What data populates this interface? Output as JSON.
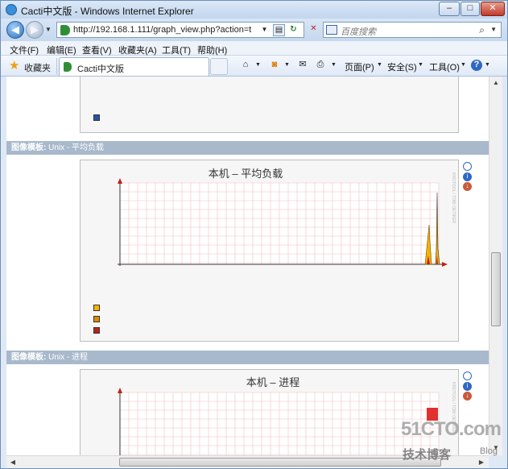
{
  "window": {
    "title": "Cacti中文版 - Windows Internet Explorer",
    "buttons": {
      "minimize": "–",
      "maximize": "□",
      "close": "✕"
    }
  },
  "nav": {
    "url": "http://192.168.1.111/graph_view.php?action=t",
    "search_placeholder": "百度搜索"
  },
  "menu": [
    "文件(F)",
    "编辑(E)",
    "查看(V)",
    "收藏夹(A)",
    "工具(T)",
    "帮助(H)"
  ],
  "favorites": {
    "label": "收藏夹",
    "tab_label": "Cacti中文版"
  },
  "command_bar": {
    "page": "页面(P)",
    "safety": "安全(S)",
    "tools": "工具(O)"
  },
  "content": {
    "sections": [
      {
        "header_label": "图像模板:",
        "header_name": "Unix - 平均负载",
        "graph_title": "本机 – 平均负载",
        "side_text": "RRDTOOL / TOBI OETIKER",
        "legend_colors": [
          "#f4b400",
          "#e08a00",
          "#c0201a"
        ]
      },
      {
        "header_label": "图像模板:",
        "header_name": "Unix - 进程",
        "graph_title": "本机 – 进程",
        "side_text": "RRDTOOL / TOBI OETIKER",
        "legend_colors": []
      }
    ],
    "top_partial_legend_color": "#2a52a8"
  },
  "watermark": {
    "brand": "51CTO.com",
    "sub": "技术博客",
    "blog": "Blog"
  }
}
